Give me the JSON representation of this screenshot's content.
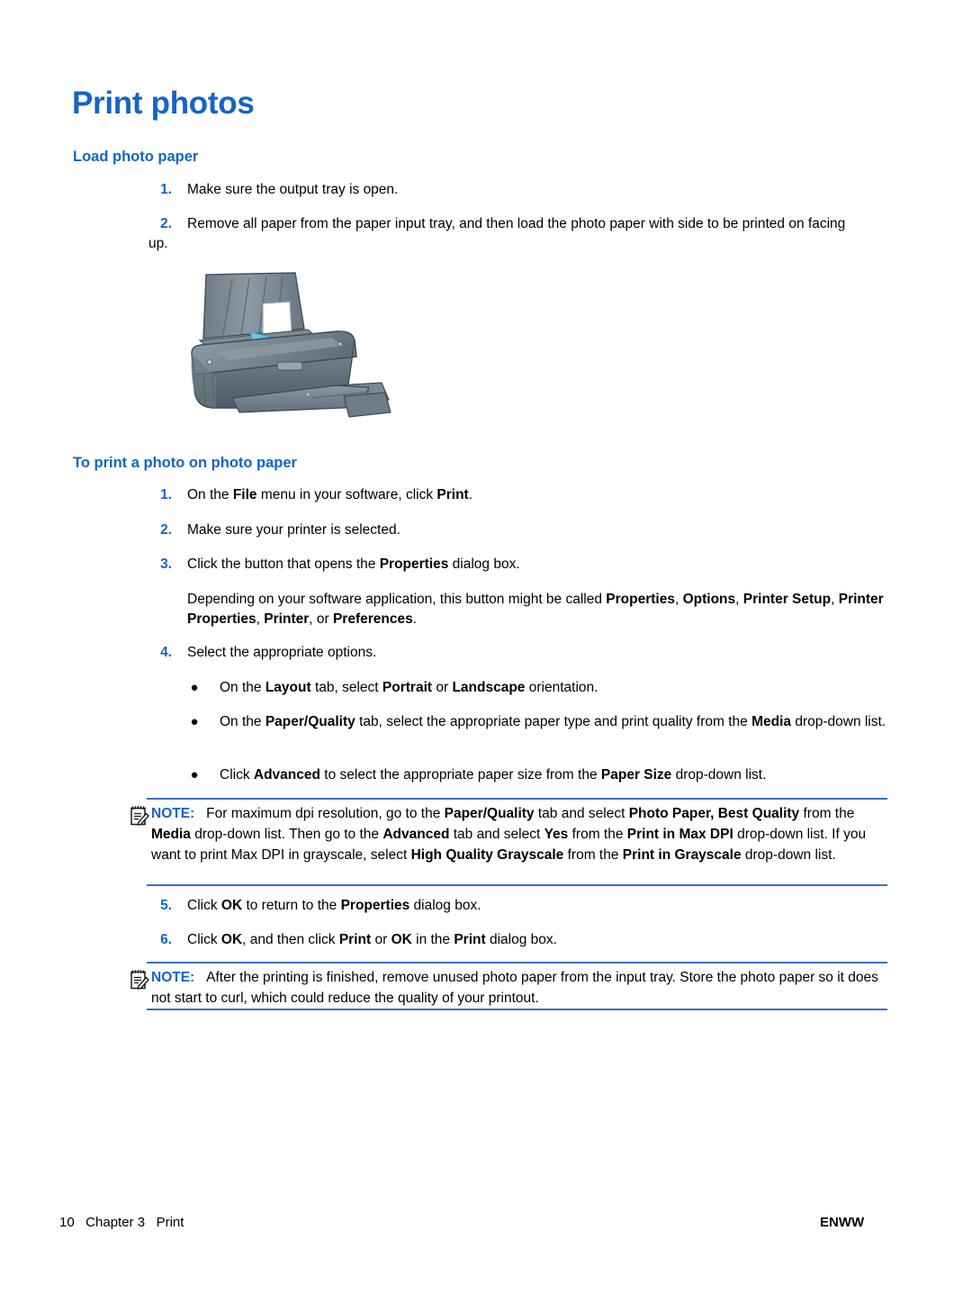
{
  "document": {
    "title": "Print photos",
    "accent_color": "#1464C8",
    "note_rule_color": "#3A6FC4"
  },
  "sections": [
    {
      "heading": "Load photo paper"
    },
    {
      "heading": "To print a photo on photo paper"
    }
  ],
  "load_steps": [
    {
      "num": "1.",
      "text": "Make sure the output tray is open."
    },
    {
      "num": "2.",
      "text": "Remove all paper from the paper input tray, and then load the photo paper with side to be printed on facing up."
    }
  ],
  "figure": {
    "name": "printer-illustration",
    "alt": "HP inkjet printer with photo paper loaded in the input tray and a blue arrow showing the loading direction",
    "arrow_color": "#6FC3E8",
    "body_color": "#5A6872"
  },
  "print_steps": [
    {
      "num": "1.",
      "text_parts": [
        "On the ",
        "File",
        " menu in your software, click ",
        "Print",
        "."
      ]
    },
    {
      "num": "2.",
      "text_parts": [
        "Make sure your printer is selected."
      ]
    },
    {
      "num": "3.",
      "text_parts": [
        "Click the button that opens the ",
        "Properties",
        " dialog box."
      ]
    },
    {
      "num": "4.",
      "text_parts": [
        "Select the appropriate options."
      ]
    },
    {
      "num": "5.",
      "text_parts": [
        "Click ",
        "OK",
        " to return to the ",
        "Properties",
        " dialog box."
      ]
    },
    {
      "num": "6.",
      "text_parts": [
        "Click ",
        "OK",
        ", and then click ",
        "Print",
        " or ",
        "OK",
        " in the ",
        "Print",
        " dialog box."
      ]
    }
  ],
  "depends_paragraph": {
    "text": "Depending on your software application, this button might be called Properties, Options, Printer Setup, Printer Properties, Printer, or Preferences."
  },
  "bullets": [
    {
      "text": "On the Layout tab, select Portrait or Landscape orientation."
    },
    {
      "text": "On the Paper/Quality tab, select the appropriate paper type and print quality from the Media drop-down list."
    },
    {
      "text": "Click Advanced to select the appropriate paper size from the Paper Size drop-down list."
    }
  ],
  "notes": [
    {
      "label": "NOTE:",
      "text": "For maximum dpi resolution, go to the Paper/Quality tab and select Photo Paper, Best Quality from the Media drop-down list. Then go to the Advanced tab and select Yes from the Print in Max DPI drop-down list. If you want to print Max DPI in grayscale, select High Quality Grayscale from the Print in Grayscale drop-down list."
    },
    {
      "label": "NOTE:",
      "text": "After the printing is finished, remove unused photo paper from the input tray. Store the photo paper so it does not start to curl, which could reduce the quality of your printout."
    }
  ],
  "footer": {
    "left": "10   Chapter 3   Print",
    "right": "ENWW"
  }
}
